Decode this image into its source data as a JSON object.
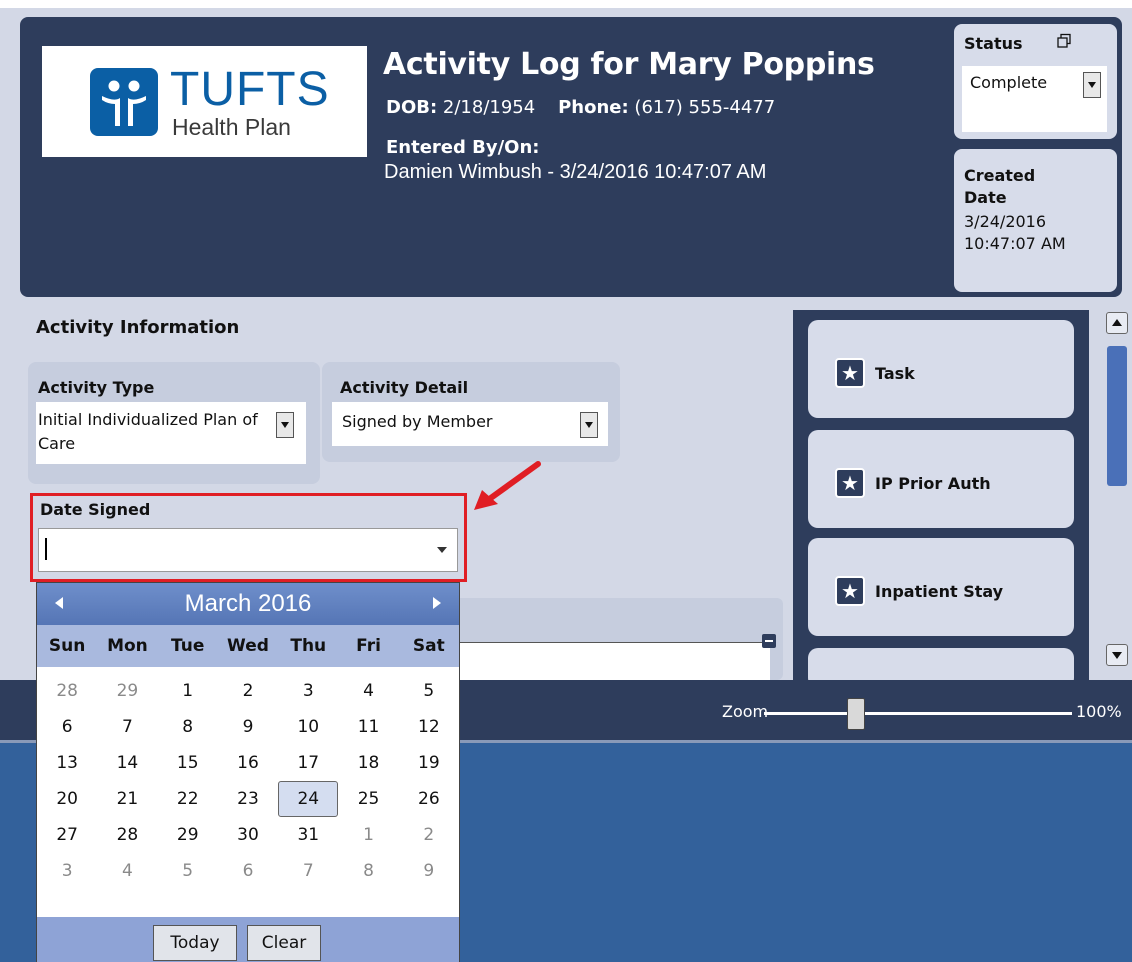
{
  "header": {
    "logo": {
      "name": "TUFTS",
      "sub": "Health Plan"
    },
    "title": "Activity Log for Mary Poppins",
    "dob_label": "DOB:",
    "dob_value": "2/18/1954",
    "phone_label": "Phone:",
    "phone_value": "(617) 555-4477",
    "entered_label": "Entered By/On:",
    "entered_value": "Damien Wimbush - 3/24/2016 10:47:07 AM",
    "status_label": "Status",
    "status_value": "Complete",
    "created_label": "Created Date",
    "created_value": "3/24/2016 10:47:07 AM"
  },
  "activity": {
    "section_title": "Activity Information",
    "type_label": "Activity Type",
    "type_value": "Initial Individualized Plan of Care",
    "detail_label": "Activity Detail",
    "detail_value": "Signed by Member",
    "date_label": "Date Signed",
    "date_value": ""
  },
  "calendar": {
    "month_title": "March 2016",
    "weekdays": [
      "Sun",
      "Mon",
      "Tue",
      "Wed",
      "Thu",
      "Fri",
      "Sat"
    ],
    "weeks": [
      [
        "28",
        "29",
        "1",
        "2",
        "3",
        "4",
        "5"
      ],
      [
        "6",
        "7",
        "8",
        "9",
        "10",
        "11",
        "12"
      ],
      [
        "13",
        "14",
        "15",
        "16",
        "17",
        "18",
        "19"
      ],
      [
        "20",
        "21",
        "22",
        "23",
        "24",
        "25",
        "26"
      ],
      [
        "27",
        "28",
        "29",
        "30",
        "31",
        "1",
        "2"
      ],
      [
        "3",
        "4",
        "5",
        "6",
        "7",
        "8",
        "9"
      ]
    ],
    "today": "24",
    "today_button": "Today",
    "clear_button": "Clear"
  },
  "tiles": [
    {
      "label": "Task",
      "icon": "star-icon"
    },
    {
      "label": "IP Prior Auth",
      "icon": "star-icon"
    },
    {
      "label": "Inpatient Stay",
      "icon": "star-icon"
    }
  ],
  "statusbar": {
    "zoom_label": "Zoom",
    "zoom_value": "100%",
    "zoom_level": 0.3
  },
  "colors": {
    "header_bg": "#2e3d5c",
    "highlight": "#e01e24",
    "accent": "#5575b5",
    "brand": "#0b5fa5"
  }
}
